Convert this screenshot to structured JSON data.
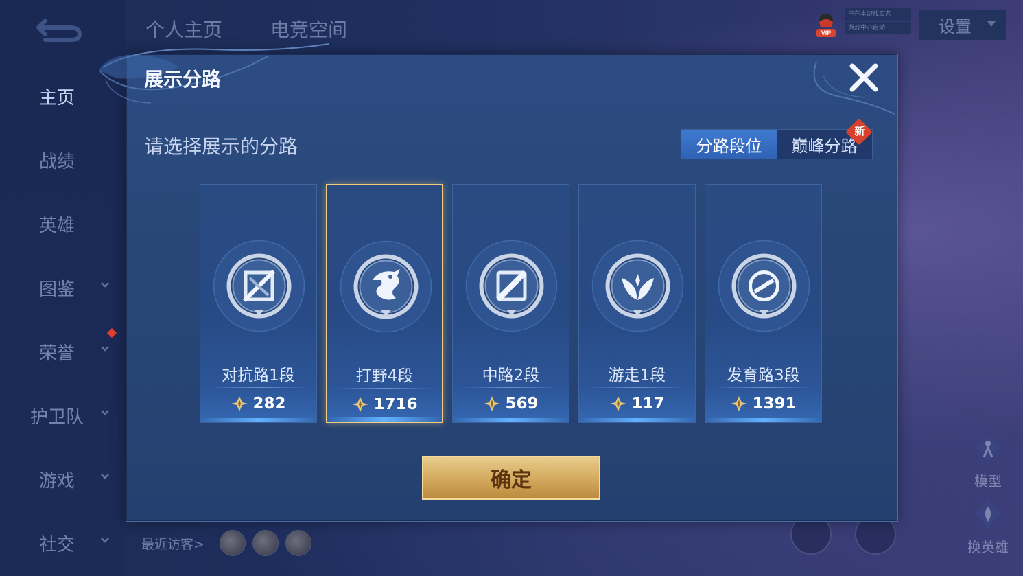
{
  "nav": {
    "top_tabs": [
      "个人主页",
      "电竞空间"
    ],
    "side_items": [
      {
        "label": "主页",
        "has_chevron": false,
        "active": true
      },
      {
        "label": "战绩",
        "has_chevron": false,
        "active": false
      },
      {
        "label": "英雄",
        "has_chevron": false,
        "active": false
      },
      {
        "label": "图鉴",
        "has_chevron": true,
        "active": false
      },
      {
        "label": "荣誉",
        "has_chevron": true,
        "active": false
      },
      {
        "label": "护卫队",
        "has_chevron": true,
        "active": false
      },
      {
        "label": "游戏",
        "has_chevron": true,
        "active": false
      },
      {
        "label": "社交",
        "has_chevron": true,
        "active": false
      }
    ]
  },
  "top_right": {
    "verify_line1": "已在本游戏实名",
    "verify_line2": "游戏中心启动",
    "settings_label": "设置"
  },
  "bottom": {
    "visitors_label": "最近访客>",
    "model_label": "模型",
    "switch_hero_label": "换英雄"
  },
  "modal": {
    "title": "展示分路",
    "subtitle": "请选择展示的分路",
    "tabs": [
      {
        "label": "分路段位",
        "active": true
      },
      {
        "label": "巅峰分路",
        "active": false
      }
    ],
    "new_badge": "新",
    "confirm_label": "确定",
    "lanes": [
      {
        "name": "对抗路1段",
        "score": "282",
        "icon": "sword-emblem-icon",
        "selected": false
      },
      {
        "name": "打野4段",
        "score": "1716",
        "icon": "dragon-emblem-icon",
        "selected": true
      },
      {
        "name": "中路2段",
        "score": "569",
        "icon": "staff-emblem-icon",
        "selected": false
      },
      {
        "name": "游走1段",
        "score": "117",
        "icon": "wings-emblem-icon",
        "selected": false
      },
      {
        "name": "发育路3段",
        "score": "1391",
        "icon": "shield-emblem-icon",
        "selected": false
      }
    ]
  },
  "colors": {
    "accent_gold": "#f1cc7e",
    "active_tab": "#3f7ad0",
    "badge_red": "#d9412f"
  }
}
